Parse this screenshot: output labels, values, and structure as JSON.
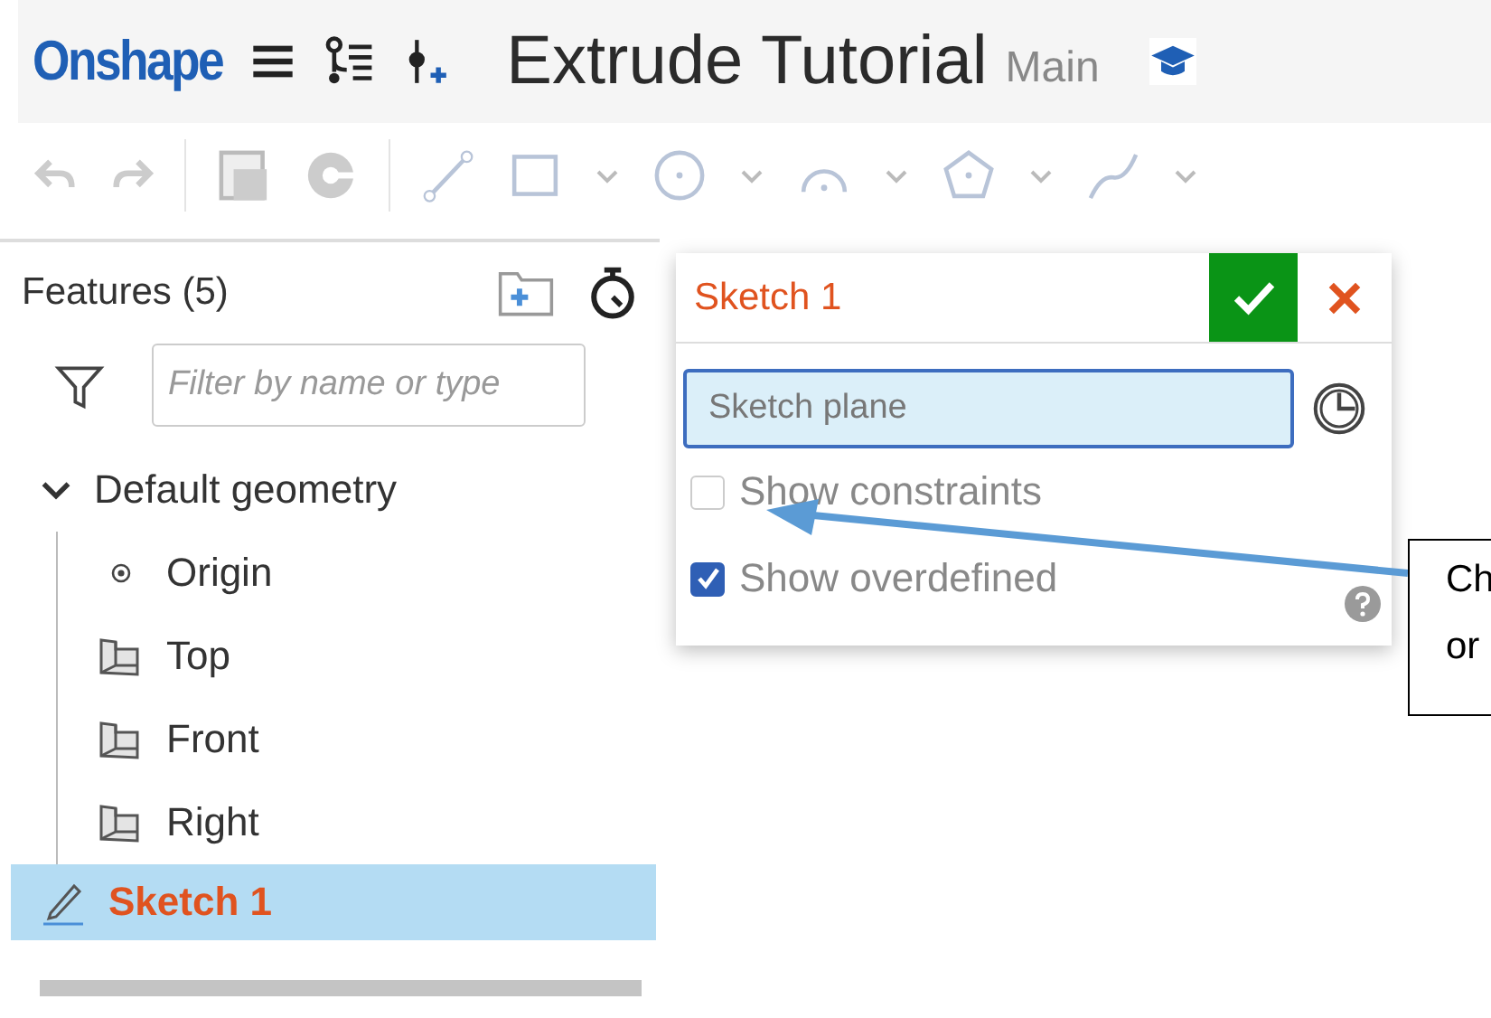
{
  "header": {
    "logo": "Onshape",
    "title": "Extrude Tutorial",
    "branch": "Main"
  },
  "features_panel": {
    "title": "Features (5)",
    "filter": {
      "placeholder": "Filter by name or type"
    },
    "tree": [
      {
        "label": "Default geometry",
        "kind": "group",
        "expanded": true,
        "selected": false,
        "children": [
          {
            "label": "Origin",
            "kind": "point",
            "selected": false
          },
          {
            "label": "Top",
            "kind": "plane",
            "selected": false
          },
          {
            "label": "Front",
            "kind": "plane",
            "selected": false
          },
          {
            "label": "Right",
            "kind": "plane",
            "selected": false
          }
        ]
      },
      {
        "label": "Sketch 1",
        "kind": "sketch",
        "selected": true
      }
    ]
  },
  "dialog": {
    "title": "Sketch 1",
    "plane_field": {
      "placeholder": "Sketch plane"
    },
    "options": [
      {
        "label": "Show constraints",
        "checked": false
      },
      {
        "label": "Show overdefined",
        "checked": true
      }
    ]
  },
  "callout": {
    "lines": [
      "Ch",
      "or"
    ]
  }
}
